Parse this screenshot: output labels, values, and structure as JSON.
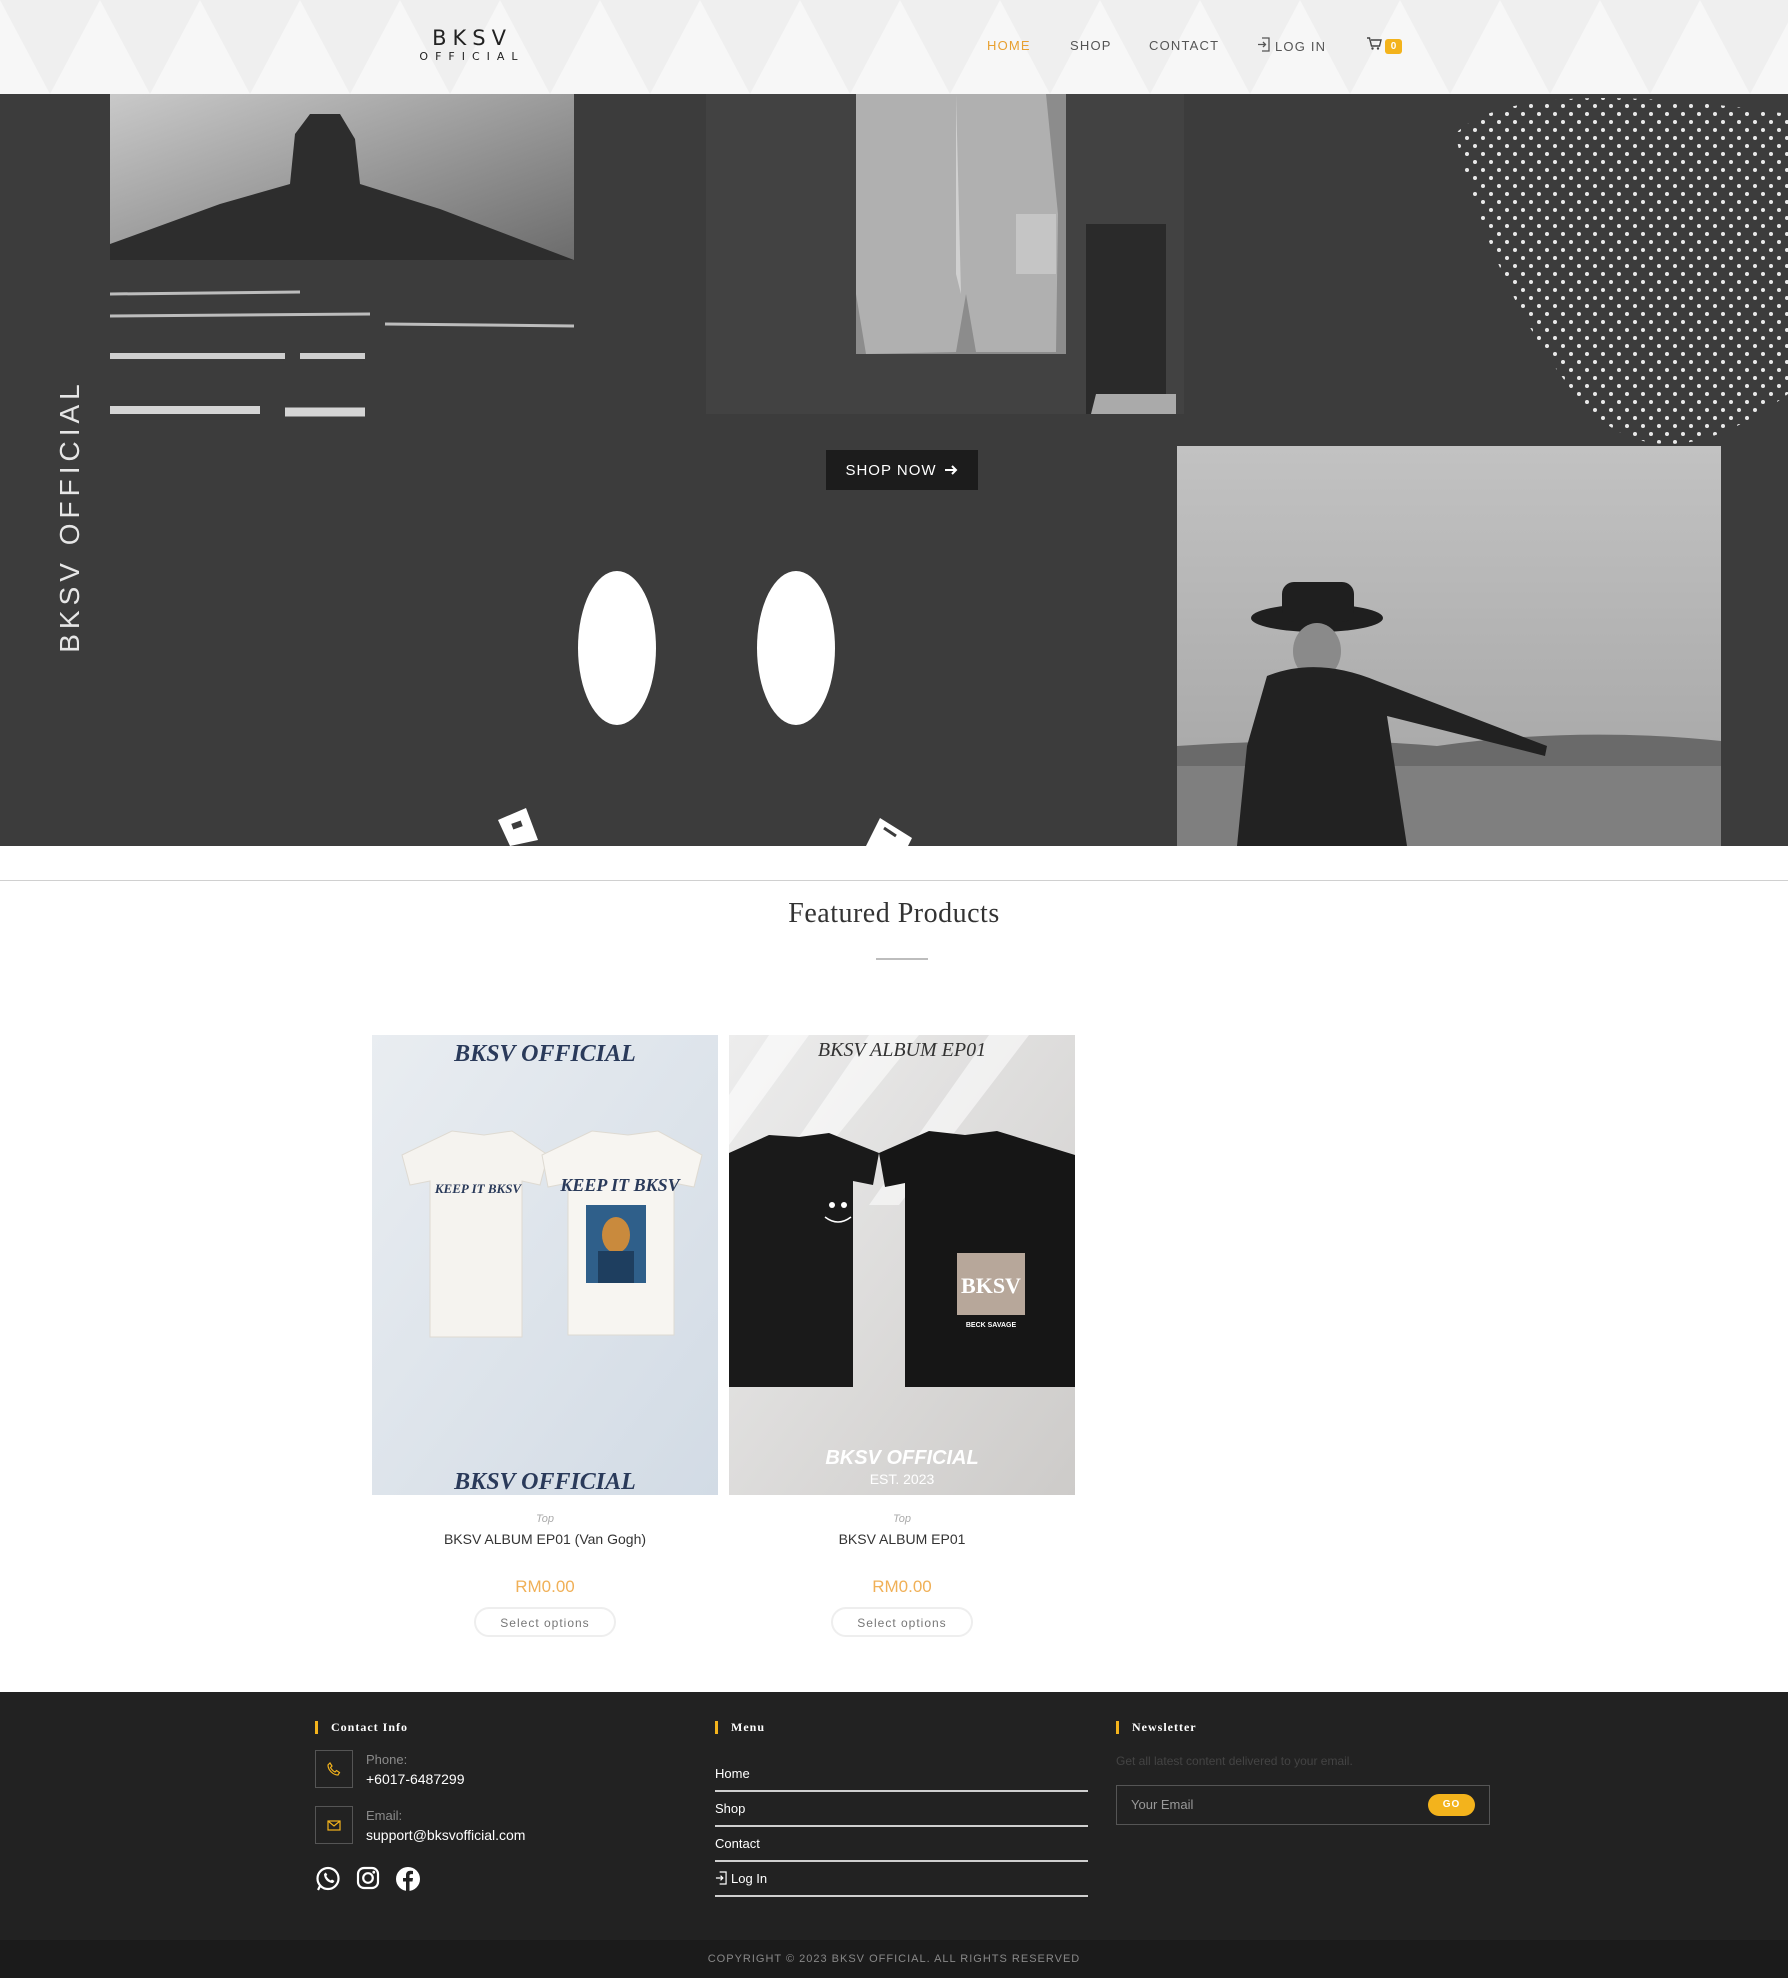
{
  "header": {
    "logo_line1": "BKSV",
    "logo_line2": "OFFICIAL",
    "nav": [
      {
        "label": "HOME",
        "active": true
      },
      {
        "label": "SHOP",
        "active": false
      },
      {
        "label": "CONTACT",
        "active": false
      },
      {
        "label": "LOG IN",
        "active": false
      }
    ],
    "cart_count": "0",
    "accent_color": "#e8a030"
  },
  "hero": {
    "vertical_text": "BKSV OFFICIAL",
    "button_label": "SHOP NOW",
    "button_icon": "arrow-right-icon"
  },
  "featured": {
    "title": "Featured Products",
    "products": [
      {
        "category": "Top",
        "name": "BKSV ALBUM EP01 (Van Gogh)",
        "price": "RM0.00",
        "button": "Select options",
        "image_header": "BKSV OFFICIAL",
        "image_footer": "BKSV OFFICIAL",
        "shirt_text": "KEEP IT BKSV"
      },
      {
        "category": "Top",
        "name": "BKSV ALBUM EP01",
        "price": "RM0.00",
        "button": "Select options",
        "image_header": "BKSV ALBUM EP01",
        "image_footer": "BKSV OFFICIAL",
        "image_footer_sub": "EST. 2023",
        "shirt_text": "BKSV",
        "shirt_sub": "BECK SAVAGE"
      }
    ]
  },
  "footer": {
    "contact": {
      "title": "Contact Info",
      "phone_label": "Phone:",
      "phone": "+6017-6487299",
      "email_label": "Email:",
      "email": "support@bksvofficial.com"
    },
    "menu": {
      "title": "Menu",
      "items": [
        "Home",
        "Shop",
        "Contact",
        "Log In"
      ]
    },
    "newsletter": {
      "title": "Newsletter",
      "description": "Get all latest content delivered to your email.",
      "placeholder": "Your Email",
      "button": "GO"
    },
    "copyright": "COPYRIGHT © 2023 BKSV OFFICIAL. ALL RIGHTS RESERVED"
  }
}
